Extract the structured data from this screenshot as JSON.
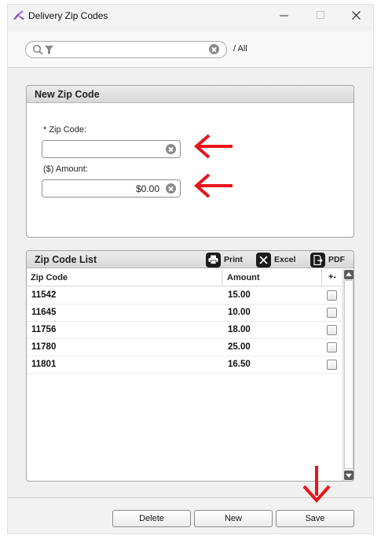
{
  "window": {
    "title": "Delivery Zip Codes"
  },
  "search": {
    "placeholder": "",
    "value": "",
    "scope": "/ All"
  },
  "new_zip": {
    "title": "New Zip Code",
    "zip_label": "* Zip Code:",
    "zip_value": "",
    "amount_label": "($) Amount:",
    "amount_value": "$0.00"
  },
  "list": {
    "title": "Zip Code List",
    "tools": {
      "print": "Print",
      "excel": "Excel",
      "pdf": "PDF"
    },
    "columns": {
      "zip": "Zip Code",
      "amount": "Amount",
      "add": "+-"
    },
    "rows": [
      {
        "zip": "11542",
        "amount": "15.00"
      },
      {
        "zip": "11645",
        "amount": "10.00"
      },
      {
        "zip": "11756",
        "amount": "18.00"
      },
      {
        "zip": "11780",
        "amount": "25.00"
      },
      {
        "zip": "11801",
        "amount": "16.50"
      }
    ]
  },
  "buttons": {
    "delete": "Delete",
    "new": "New",
    "save": "Save"
  },
  "colors": {
    "annotation_arrow": "#e8141b",
    "tool_icon_bg": "#1b1b1b"
  }
}
